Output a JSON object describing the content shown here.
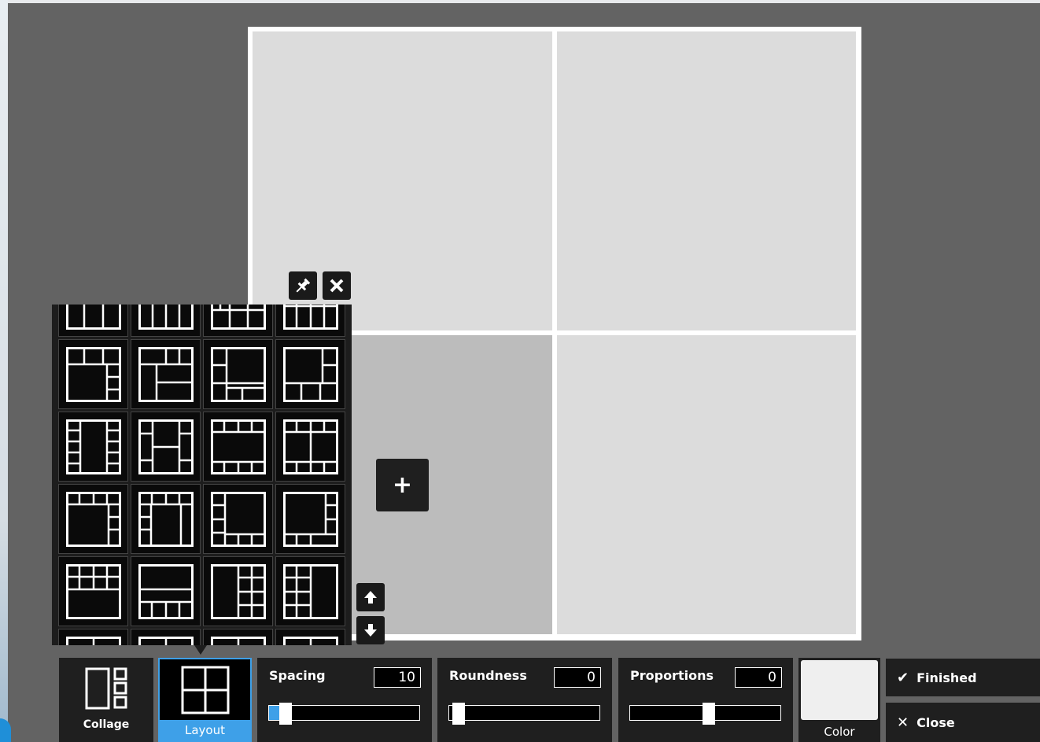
{
  "canvas": {
    "add_label": "+"
  },
  "picker": {
    "pin_icon": "pin-icon",
    "close_icon": "close-icon",
    "scroll_up_icon": "arrow-up-icon",
    "scroll_down_icon": "arrow-down-icon"
  },
  "toolbar": {
    "collage_label": "Collage",
    "layout_label": "Layout",
    "spacing": {
      "label": "Spacing",
      "value": "10",
      "level": 0.05
    },
    "roundness": {
      "label": "Roundness",
      "value": "0",
      "level": 0.0
    },
    "proportions": {
      "label": "Proportions",
      "value": "0",
      "level": 0.5
    },
    "color_label": "Color",
    "color_value": "#efefef",
    "finished_label": "Finished",
    "close_label": "Close"
  },
  "colors": {
    "accent": "#3ea0e8",
    "background": "#636363",
    "panel": "#1f1f1f"
  }
}
